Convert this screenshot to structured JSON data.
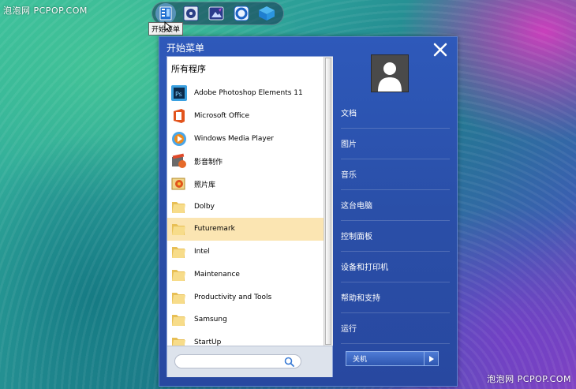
{
  "watermark": "泡泡网 PCPOP.COM",
  "taskbar": {
    "tooltip": "开始菜单",
    "icons": [
      "start-menu-icon",
      "disc-app-icon",
      "photo-app-icon",
      "camera-app-icon",
      "cloud-box-icon"
    ]
  },
  "start_menu": {
    "title": "开始菜单",
    "all_programs_label": "所有程序",
    "programs": [
      {
        "label": "Adobe Photoshop Elements 11",
        "icon": "photoshop-icon"
      },
      {
        "label": "Microsoft Office",
        "icon": "office-icon"
      },
      {
        "label": "Windows Media Player",
        "icon": "media-player-icon"
      },
      {
        "label": "影音制作",
        "icon": "movie-maker-icon"
      },
      {
        "label": "照片库",
        "icon": "photo-gallery-icon"
      },
      {
        "label": "Dolby",
        "icon": "folder-icon"
      },
      {
        "label": "Futuremark",
        "icon": "folder-icon",
        "selected": true
      },
      {
        "label": "Intel",
        "icon": "folder-icon"
      },
      {
        "label": "Maintenance",
        "icon": "folder-icon"
      },
      {
        "label": "Productivity and Tools",
        "icon": "folder-icon"
      },
      {
        "label": "Samsung",
        "icon": "folder-icon"
      },
      {
        "label": "StartUp",
        "icon": "folder-icon"
      }
    ],
    "search_placeholder": "",
    "right_items": [
      "文档",
      "图片",
      "音乐",
      "这台电脑",
      "控制面板",
      "设备和打印机",
      "帮助和支持",
      "运行"
    ],
    "shutdown_label": "关机"
  },
  "colors": {
    "menu_bg": "#2a4fa8",
    "selected_row": "#fbe5b2",
    "folder": "#f3cf6a"
  }
}
